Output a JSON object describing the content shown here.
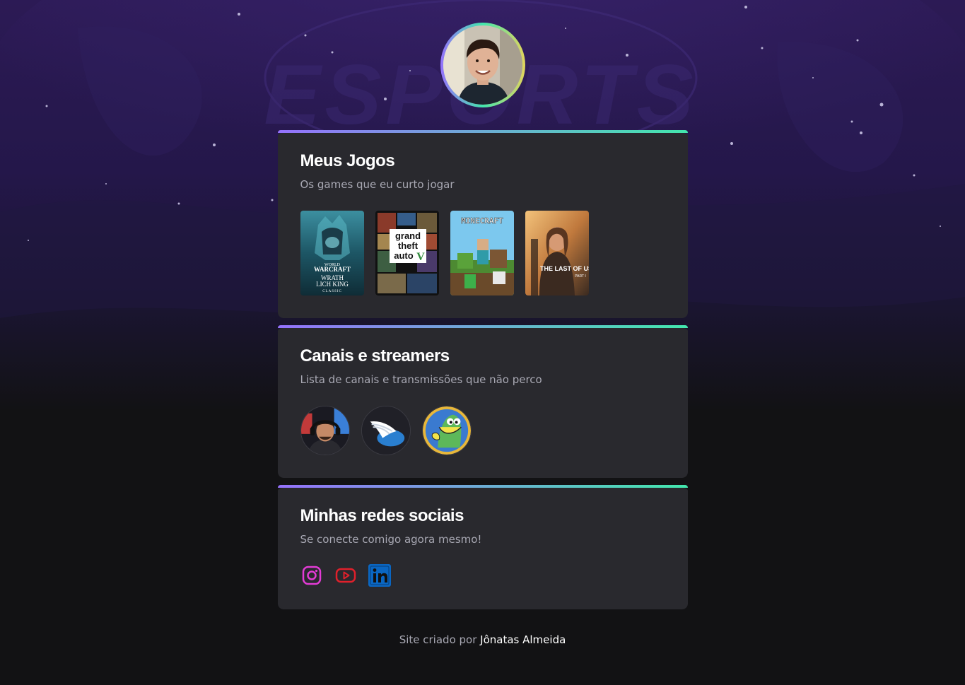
{
  "profile": {
    "avatar_icon": "profile-photo"
  },
  "games_card": {
    "title": "Meus Jogos",
    "subtitle": "Os games que eu curto jogar",
    "items": [
      {
        "name": "World of Warcraft: Wrath of the Lich King Classic",
        "cover_text": [
          "WORLD",
          "WARCRAFT",
          "WRATH",
          "LICH KING",
          "CLASSIC"
        ]
      },
      {
        "name": "Grand Theft Auto V",
        "cover_text": [
          "grand",
          "theft",
          "auto",
          "V"
        ]
      },
      {
        "name": "Minecraft",
        "cover_text": [
          "MINECRAFT"
        ]
      },
      {
        "name": "The Last of Us Part I",
        "cover_text": [
          "THE LAST OF US",
          "PART I"
        ]
      }
    ]
  },
  "streamers_card": {
    "title": "Canais e streamers",
    "subtitle": "Lista de canais e transmissões que não perco",
    "items": [
      {
        "name": "streamer-1"
      },
      {
        "name": "streamer-2"
      },
      {
        "name": "streamer-3"
      }
    ]
  },
  "social_card": {
    "title": "Minhas redes sociais",
    "subtitle": "Se conecte comigo agora mesmo!",
    "items": [
      {
        "name": "instagram-icon",
        "color": "#E23BD5"
      },
      {
        "name": "youtube-icon",
        "color": "#E0202B"
      },
      {
        "name": "linkedin-icon",
        "color": "#0A66C2"
      }
    ]
  },
  "footer": {
    "prefix": "Site criado por",
    "author": "Jônatas Almeida"
  },
  "colors": {
    "background": "#121214",
    "card": "#29292E",
    "accent_start": "#9572FC",
    "accent_end": "#43E7AD",
    "muted_text": "#A8A8B3"
  }
}
